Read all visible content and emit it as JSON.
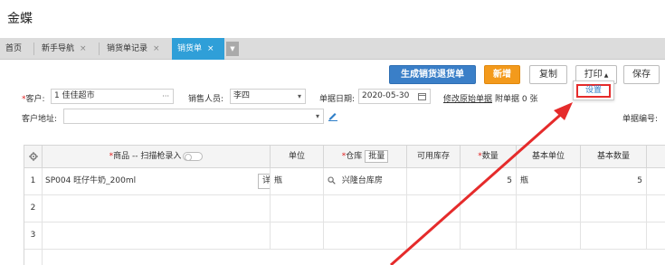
{
  "app": {
    "title": "金蝶"
  },
  "tabs": [
    {
      "label": "首页",
      "closable": false,
      "active": false
    },
    {
      "label": "新手导航",
      "closable": true,
      "active": false
    },
    {
      "label": "销货单记录",
      "closable": true,
      "active": false
    },
    {
      "label": "销货单",
      "closable": true,
      "active": true
    }
  ],
  "tab_close_glyph": "×",
  "tab_more_glyph": "▼",
  "toolbar": {
    "generate_return": "生成销货退货单",
    "new": "新增",
    "copy": "复制",
    "print": "打印",
    "print_arrow": "▲",
    "save": "保存",
    "dropdown_setting": "设置"
  },
  "form": {
    "customer_label": "客户:",
    "customer_value": "1 佳佳超市",
    "customer_more": "···",
    "salesperson_label": "销售人员:",
    "salesperson_value": "李四",
    "select_arrow": "▾",
    "date_label": "单据日期:",
    "date_value": "2020-05-30",
    "modify_source_link": "修改原始单据",
    "attachment_label": "附单据",
    "attachment_count": "0",
    "attachment_unit": "张",
    "address_label": "客户地址:",
    "address_value": "",
    "doc_number_label": "单据编号:"
  },
  "grid": {
    "columns": {
      "product": "商品",
      "product_scan": " -- 扫描枪录入",
      "unit": "单位",
      "warehouse": "仓库",
      "batch_btn": "批量",
      "available": "可用库存",
      "quantity": "数量",
      "base_unit": "基本单位",
      "base_quantity": "基本数量"
    },
    "rows": [
      {
        "no": "1",
        "product": "SP004 旺仔牛奶_200ml",
        "detail": "详情",
        "unit": "瓶",
        "warehouse": "兴隆台库房",
        "available": "",
        "quantity": "5",
        "base_unit": "瓶",
        "base_quantity": "5"
      },
      {
        "no": "2",
        "product": "",
        "detail": "",
        "unit": "",
        "warehouse": "",
        "available": "",
        "quantity": "",
        "base_unit": "",
        "base_quantity": ""
      },
      {
        "no": "3",
        "product": "",
        "detail": "",
        "unit": "",
        "warehouse": "",
        "available": "",
        "quantity": "",
        "base_unit": "",
        "base_quantity": ""
      }
    ]
  },
  "colors": {
    "accent_blue": "#3a7fc8",
    "active_tab": "#2f9fd8",
    "new_button": "#f39a1c",
    "highlight_red": "#e52b2b"
  },
  "icons": {
    "settings": "gear-icon",
    "calendar": "calendar-icon",
    "search": "search-icon",
    "edit": "pencil-icon"
  }
}
